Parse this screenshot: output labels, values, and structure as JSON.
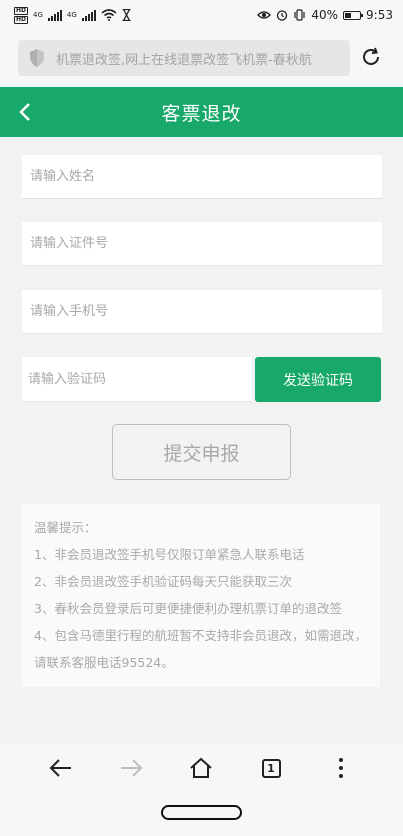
{
  "status_bar": {
    "battery": "40%",
    "battery_level": 0.4,
    "time": "9:53",
    "hd_label": "HD",
    "network_4g": "4G",
    "icons": [
      "hd-icon",
      "signal-icon",
      "wifi-icon",
      "hourglass-icon",
      "eye-icon",
      "alarm-icon",
      "vibrate-icon",
      "battery-icon"
    ]
  },
  "browser": {
    "url_text": "机票退改签,网上在线退票改签飞机票-春秋航",
    "icons": [
      "shield-icon",
      "refresh-icon"
    ]
  },
  "header": {
    "title": "客票退改",
    "icons": [
      "back-arrow-icon"
    ]
  },
  "form": {
    "name_placeholder": "请输入姓名",
    "id_placeholder": "请输入证件号",
    "phone_placeholder": "请输入手机号",
    "code_placeholder": "请输入验证码",
    "send_code_label": "发送验证码",
    "submit_label": "提交申报"
  },
  "tips": {
    "heading": "温馨提示：",
    "items": [
      "1、非会员退改签手机号仅限订单紧急人联系电话",
      "2、非会员退改签手机验证码每天只能获取三次",
      "3、春秋会员登录后可更便捷便利办理机票订单的退改签",
      "4、包含马德里行程的航班暂不支持非会员退改，如需退改，请联系客服电话95524。"
    ]
  },
  "toolbar": {
    "tab_count": "1",
    "icons": [
      "back-icon",
      "forward-icon",
      "home-icon",
      "tabs-icon",
      "more-icon"
    ]
  },
  "colors": {
    "accent": "#17a86a",
    "placeholder": "#a8a8a8",
    "background": "#f2f2f2"
  }
}
